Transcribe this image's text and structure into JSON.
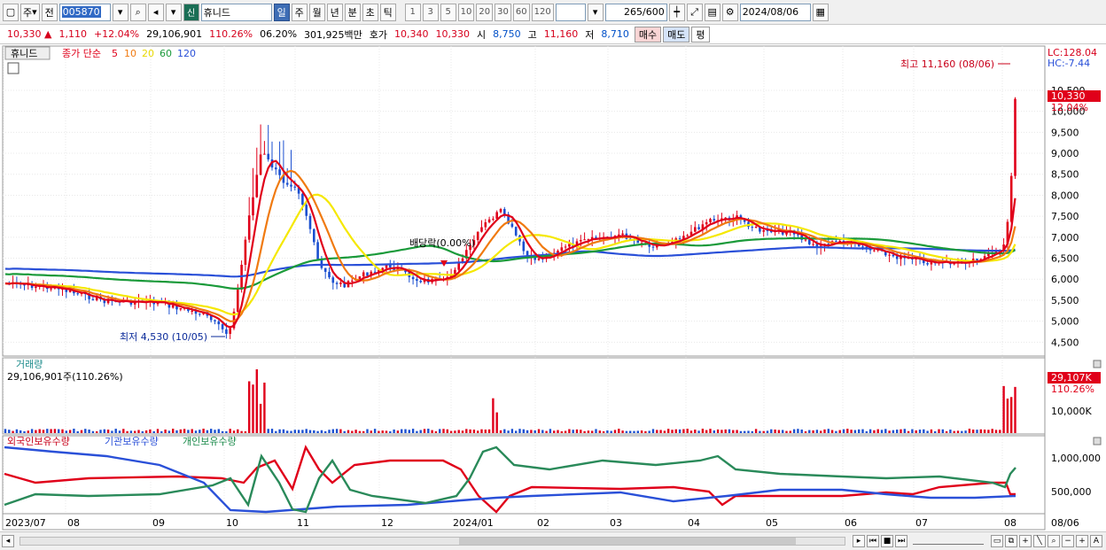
{
  "toolbar": {
    "mode_label": "주",
    "prev_label": "전",
    "stock_code": "005870",
    "new_badge": "신",
    "stock_name": "휴니드",
    "periods": [
      "일",
      "주",
      "월",
      "년",
      "분",
      "초",
      "틱"
    ],
    "active_period": "일",
    "minute_buttons": [
      "1",
      "3",
      "5",
      "10",
      "20",
      "30",
      "60",
      "120"
    ],
    "data_count": "265",
    "data_max": "/600",
    "date": "2024/08/06"
  },
  "quote": {
    "price": "10,330",
    "change": "1,110",
    "change_pct": "+12.04%",
    "volume": "29,106,901",
    "volume_ratio": "110.26%",
    "turnover": "06.20%",
    "amount": "301,925백만",
    "bid_ask_label": "호가",
    "ask": "10,340",
    "bid": "10,330",
    "open_label": "시",
    "open": "8,750",
    "high_label": "고",
    "high": "11,160",
    "low_label": "저",
    "low": "8,710",
    "buy_label": "매수",
    "sell_label": "매도",
    "avg_label": "평"
  },
  "price_panel": {
    "title": "휴니드",
    "legend_prefix": "종가 단순",
    "ma_labels": [
      "5",
      "10",
      "20",
      "60",
      "120"
    ],
    "lc_label": "LC:128.04",
    "hc_label": "HC:-7.44",
    "current_price": "10,330",
    "current_pct": "12.04%",
    "high_annotation": "최고 11,160 (08/06)",
    "low_annotation": "최저 4,530 (10/05)",
    "dividend_annotation": "배당락(0.00%)",
    "y_ticks": [
      "10,500",
      "10,000",
      "9,500",
      "9,000",
      "8,500",
      "8,000",
      "7,500",
      "7,000",
      "6,500",
      "6,000",
      "5,500",
      "5,000",
      "4,500"
    ]
  },
  "volume_panel": {
    "title": "거래량",
    "value_label": "29,106,901주(110.26%)",
    "current": "29,107K",
    "current_pct": "110.26%",
    "y_tick": "10,000K"
  },
  "holder_panel": {
    "title_foreign": "외국인보유수량",
    "title_institution": "기관보유수량",
    "title_individual": "개인보유수량",
    "y_ticks": [
      "1,000,000",
      "500,000"
    ]
  },
  "x_axis": {
    "labels": [
      "2023/07",
      "08",
      "09",
      "10",
      "11",
      "12",
      "2024/01",
      "02",
      "03",
      "04",
      "05",
      "06",
      "07",
      "08"
    ],
    "end_label": "08/06"
  },
  "colors": {
    "ma5": "#e0001a",
    "ma10": "#f07a10",
    "ma20": "#f5e800",
    "ma60": "#1a9a3a",
    "ma120": "#2a50d8",
    "up": "#e0001a",
    "down": "#1a4fd0",
    "accent": "#316ac5"
  }
}
